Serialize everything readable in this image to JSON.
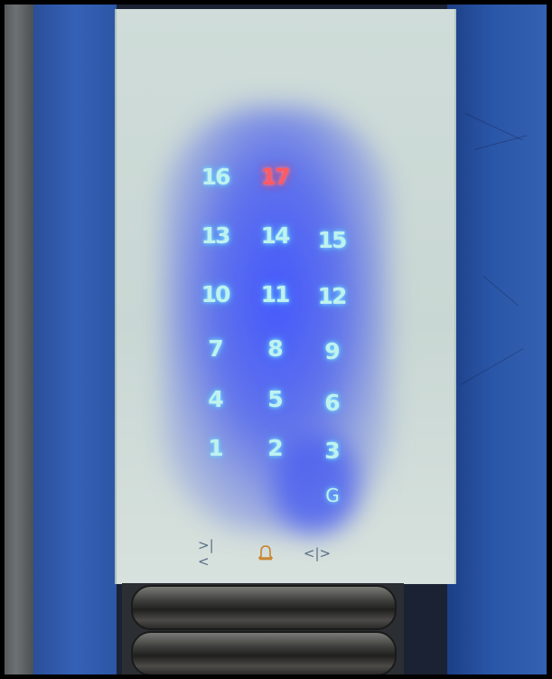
{
  "floors": [
    {
      "label": "16",
      "active": false
    },
    {
      "label": "17",
      "active": true
    },
    {
      "label": "13",
      "active": false
    },
    {
      "label": "14",
      "active": false
    },
    {
      "label": "15",
      "active": false
    },
    {
      "label": "10",
      "active": false
    },
    {
      "label": "11",
      "active": false
    },
    {
      "label": "12",
      "active": false
    },
    {
      "label": "7",
      "active": false
    },
    {
      "label": "8",
      "active": false
    },
    {
      "label": "9",
      "active": false
    },
    {
      "label": "4",
      "active": false
    },
    {
      "label": "5",
      "active": false
    },
    {
      "label": "6",
      "active": false
    },
    {
      "label": "1",
      "active": false
    },
    {
      "label": "2",
      "active": false
    },
    {
      "label": "3",
      "active": false
    },
    {
      "label": "G",
      "active": false
    }
  ],
  "controls": {
    "door_close": ">|<",
    "alarm": "bell-icon",
    "door_open": "<|>"
  },
  "colors": {
    "lit_digit": "#bff2ef",
    "selected_digit": "#ff5a63",
    "glow": "#3c50ff",
    "panel": "#cfdcd9",
    "wall_blue": "#2c56a6",
    "alarm": "#c8822a"
  }
}
